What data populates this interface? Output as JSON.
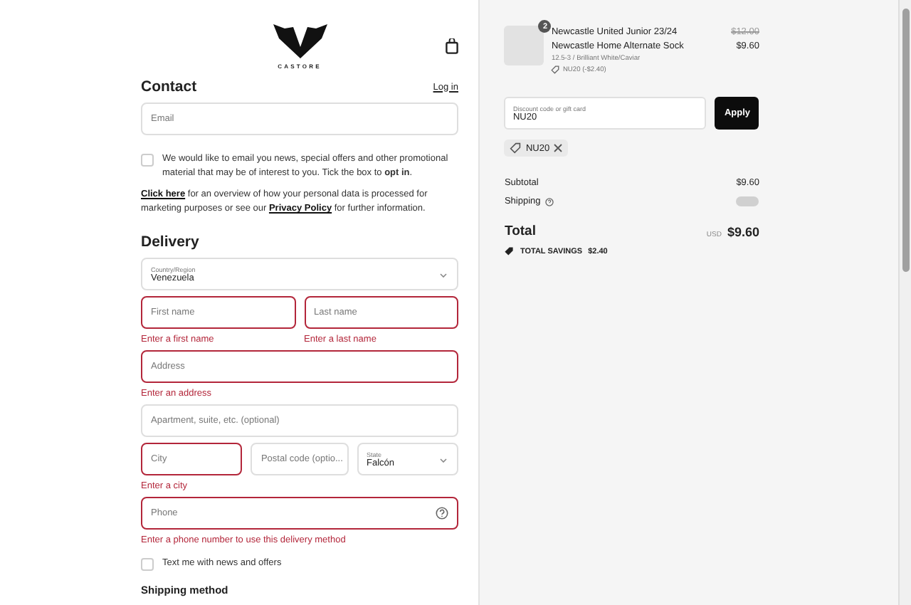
{
  "brand": {
    "name": "CASTORE"
  },
  "contact": {
    "title": "Contact",
    "login_link": "Log in",
    "email": {
      "placeholder": "Email"
    },
    "marketing_opt_in": {
      "checked": false,
      "text": "We would like to email you news, special offers and other promotional material that may be of interest to you. Tick the box to **opt in**."
    },
    "privacy_note": {
      "link_1": "Click here",
      "text_1": "for an overview of how your personal data is processed for marketing purposes or see our",
      "link_2": "Privacy Policy",
      "text_2": "for further information."
    }
  },
  "delivery": {
    "title": "Delivery",
    "country": {
      "label": "Country/Region",
      "value": "Venezuela"
    },
    "rows": [
      [
        {
          "placeholder": "First name",
          "invalid": true,
          "error": "Enter a first name"
        },
        {
          "placeholder": "Last name",
          "invalid": true,
          "error": "Enter a last name"
        }
      ],
      [
        {
          "placeholder": "Address",
          "invalid": true,
          "error": "Enter an address"
        }
      ],
      [
        {
          "placeholder": "Apartment, suite, etc. (optional)",
          "invalid": false
        }
      ],
      [
        {
          "placeholder": "City",
          "invalid": true,
          "error": "Enter a city"
        },
        {
          "placeholder": "Postal code (optio...",
          "invalid": false
        },
        {
          "kind": "select",
          "label": "State",
          "value": "Falcón",
          "invalid": false
        }
      ],
      [
        {
          "placeholder": "Phone",
          "invalid": true,
          "error": "Enter a phone number to use this delivery method",
          "help": true
        }
      ]
    ],
    "sms_opt_in": {
      "checked": false,
      "text": "Text me with news and offers"
    },
    "shipping_title": "Shipping method"
  },
  "summary": {
    "product": {
      "quantity": "2",
      "name_line_1": "Newcastle United Junior 23/24",
      "name_line_2": "Newcastle Home Alternate Sock",
      "variant": "12.5-3 / Brilliant White/Caviar",
      "discount": "NU20 (-$2.40)",
      "original_price": "$12.00",
      "price": "$9.60"
    },
    "discount_field": {
      "label": "Discount code or gift card",
      "value": "NU20"
    },
    "apply_button": "Apply",
    "applied_code": "NU20",
    "subtotal_label": "Subtotal",
    "subtotal": "$9.60",
    "shipping_label": "Shipping",
    "total_label": "Total",
    "currency": "USD",
    "total": "$9.60",
    "savings_label": "TOTAL SAVINGS",
    "savings": "$2.40"
  }
}
